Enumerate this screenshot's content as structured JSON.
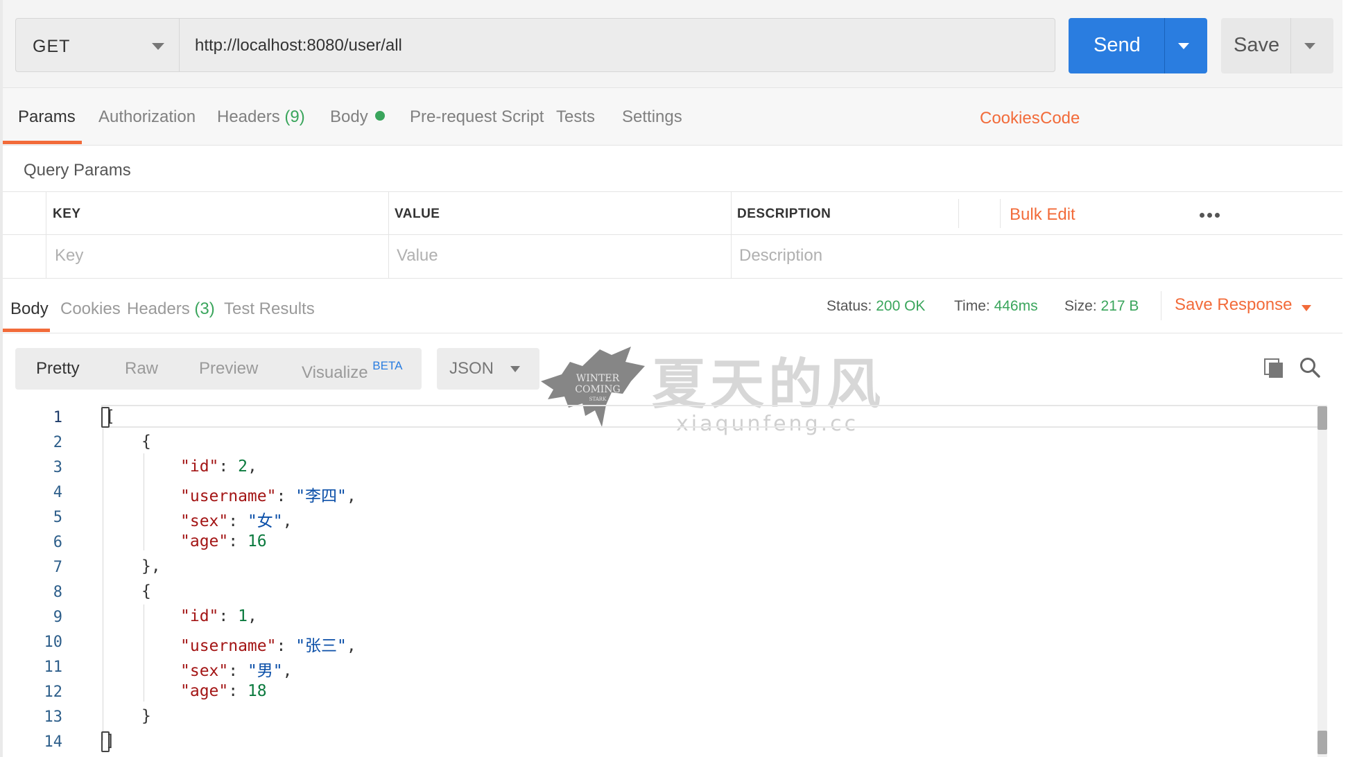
{
  "request": {
    "method": "GET",
    "url": "http://localhost:8080/user/all",
    "send_label": "Send",
    "save_label": "Save"
  },
  "request_tabs": [
    {
      "label": "Params",
      "active": true
    },
    {
      "label": "Authorization"
    },
    {
      "label": "Headers",
      "count": "(9)"
    },
    {
      "label": "Body",
      "has_content_dot": true
    },
    {
      "label": "Pre-request Script"
    },
    {
      "label": "Tests"
    },
    {
      "label": "Settings"
    }
  ],
  "request_links": {
    "cookies": "Cookies",
    "code": "Code"
  },
  "query_params": {
    "title": "Query Params",
    "headers": {
      "key": "KEY",
      "value": "VALUE",
      "description": "DESCRIPTION"
    },
    "placeholders": {
      "key": "Key",
      "value": "Value",
      "description": "Description"
    },
    "bulk_edit": "Bulk Edit"
  },
  "response": {
    "tabs": [
      {
        "label": "Body",
        "active": true
      },
      {
        "label": "Cookies"
      },
      {
        "label": "Headers",
        "count": "(3)"
      },
      {
        "label": "Test Results"
      }
    ],
    "status_label": "Status:",
    "status_value": "200 OK",
    "time_label": "Time:",
    "time_value": "446ms",
    "size_label": "Size:",
    "size_value": "217 B",
    "save_response": "Save Response"
  },
  "body_view": {
    "modes": [
      "Pretty",
      "Raw",
      "Preview",
      "Visualize"
    ],
    "beta_badge": "BETA",
    "active_mode": "Pretty",
    "format": "JSON"
  },
  "watermark": {
    "title": "夏天的风",
    "subtitle": "xiaqunfeng.cc",
    "logo_text_1": "WINTER",
    "logo_text_2": "COMING",
    "logo_text_3": "STARK"
  },
  "code": {
    "line_numbers": [
      "1",
      "2",
      "3",
      "4",
      "5",
      "6",
      "7",
      "8",
      "9",
      "10",
      "11",
      "12",
      "13",
      "14"
    ],
    "open_bracket": "[",
    "close_bracket": "]",
    "open_brace": "{",
    "close_brace_comma": "},",
    "close_brace": "}",
    "records": [
      {
        "id_key": "\"id\"",
        "id_val": "2",
        "username_key": "\"username\"",
        "username_val": "\"李四\"",
        "sex_key": "\"sex\"",
        "sex_val": "\"女\"",
        "age_key": "\"age\"",
        "age_val": "16"
      },
      {
        "id_key": "\"id\"",
        "id_val": "1",
        "username_key": "\"username\"",
        "username_val": "\"张三\"",
        "sex_key": "\"sex\"",
        "sex_val": "\"男\"",
        "age_key": "\"age\"",
        "age_val": "18"
      }
    ]
  },
  "colors": {
    "accent": "#f26b3a",
    "send_blue": "#2a7de0",
    "status_green": "#3aa55c"
  }
}
